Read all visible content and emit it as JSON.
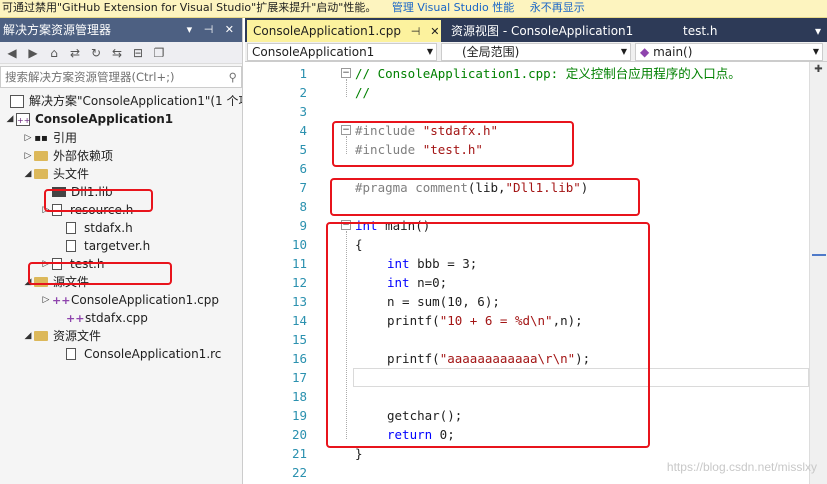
{
  "infobar": {
    "message": "可通过禁用\"GitHub Extension for Visual Studio\"扩展来提升\"启动\"性能。",
    "link_manage": "管理 Visual Studio 性能",
    "link_never": "永不再显示"
  },
  "solution_explorer": {
    "title": "解决方案资源管理器",
    "title_controls": "▾ ⊣ ✕",
    "search_placeholder": "搜索解决方案资源管理器(Ctrl+;)",
    "tree": {
      "solution": "解决方案\"ConsoleApplication1\"(1 个项目)",
      "project": "ConsoleApplication1",
      "references": "引用",
      "external_deps": "外部依赖项",
      "header_files": "头文件",
      "dll_lib": "Dll1.lib",
      "resource_h": "resource.h",
      "stdafx_h": "stdafx.h",
      "targetver_h": "targetver.h",
      "test_h": "test.h",
      "source_files": "源文件",
      "main_cpp": "ConsoleApplication1.cpp",
      "stdafx_cpp": "stdafx.cpp",
      "resource_files": "资源文件",
      "rc_file": "ConsoleApplication1.rc"
    }
  },
  "editor": {
    "tabs": {
      "active": "ConsoleApplication1.cpp",
      "resource_view": "资源视图 - ConsoleApplication1",
      "test_h": "test.h"
    },
    "nav": {
      "project": "ConsoleApplication1",
      "scope": "(全局范围)",
      "member": "main()"
    },
    "line_numbers": [
      "1",
      "2",
      "3",
      "4",
      "5",
      "6",
      "7",
      "8",
      "9",
      "10",
      "11",
      "12",
      "13",
      "14",
      "15",
      "16",
      "17",
      "18",
      "19",
      "20",
      "21",
      "22"
    ],
    "code": {
      "l1": "// ConsoleApplication1.cpp: 定义控制台应用程序的入口点。",
      "l2": "//",
      "l4_kw": "#include ",
      "l4_str": "\"stdafx.h\"",
      "l5_kw": "#include ",
      "l5_str": "\"test.h\"",
      "l7_kw": "#pragma comment",
      "l7_a": "(lib,",
      "l7_str": "\"Dll1.lib\"",
      "l7_b": ")",
      "l9_kw": "int",
      "l9_rest": " main()",
      "l10": "{",
      "l11_kw": "int",
      "l11_rest": " bbb = 3;",
      "l12_kw": "int",
      "l12_rest": " n=0;",
      "l13": "n = sum(10, 6);",
      "l14_a": "printf(",
      "l14_str": "\"10 + 6 = %d\\n\"",
      "l14_b": ",n);",
      "l16_a": "printf(",
      "l16_str": "\"aaaaaaaaaaaa\\r\\n\"",
      "l16_b": ");",
      "l18": "getchar();",
      "l19_kw": "return",
      "l19_rest": " 0;",
      "l20": "}"
    }
  },
  "watermark": "https://blog.csdn.net/misslxy",
  "colors": {
    "highlight_box": "#e8141c",
    "active_tab": "#fcf29e",
    "title_bar": "#4d6082"
  }
}
